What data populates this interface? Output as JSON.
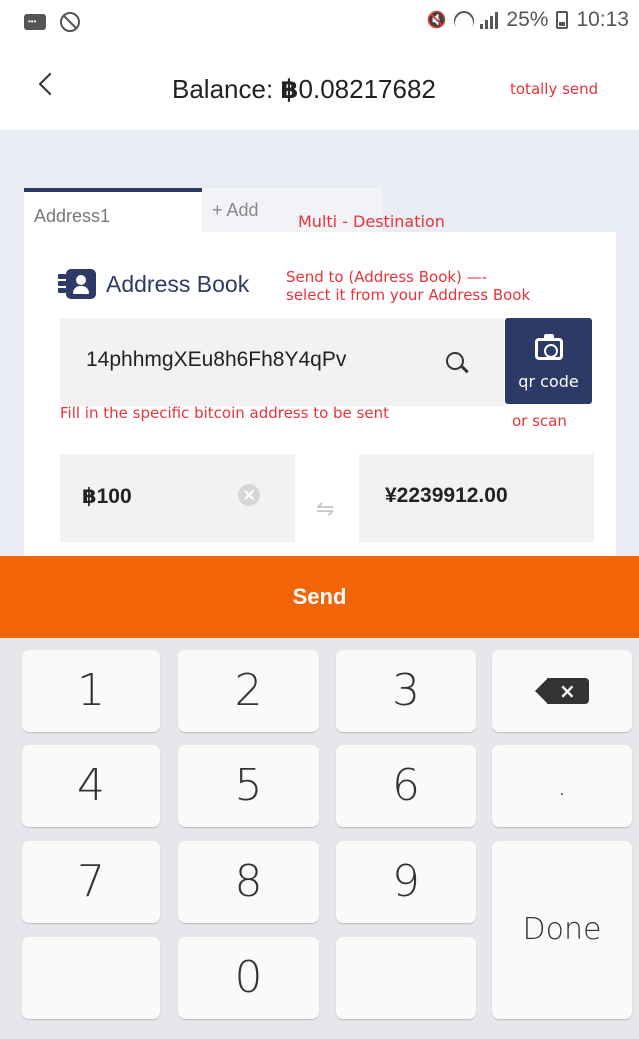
{
  "status_bar": {
    "battery_percent": "25%",
    "time": "10:13"
  },
  "header": {
    "balance_label": "Balance:",
    "balance_symbol": "฿",
    "balance_value": "0.08217682",
    "annotation": "totally send"
  },
  "tabs": {
    "items": [
      {
        "label": "Address1",
        "active": true
      },
      {
        "label": "+ Add",
        "active": false
      }
    ],
    "annotation": "Multi - Destination"
  },
  "address_book": {
    "label": "Address Book",
    "annotation_line1": "Send to (Address Book) —-",
    "annotation_line2": "select it from your Address Book"
  },
  "address_input": {
    "value": "14phhmgXEu8h6Fh8Y4qPv",
    "annotation": "Fill in the specific bitcoin address to be sent"
  },
  "qr_button": {
    "label": "qr code",
    "annotation": "or scan"
  },
  "amount": {
    "btc_value": "฿100",
    "fiat_value": "¥2239912.00",
    "swap_symbol": "⇋"
  },
  "send_button": {
    "label": "Send"
  },
  "keyboard": {
    "keys": [
      "1",
      "2",
      "3",
      "4",
      "5",
      "6",
      "7",
      "8",
      "9",
      "0"
    ],
    "dot": ".",
    "delete_symbol": "×",
    "done": "Done"
  },
  "colors": {
    "accent_navy": "#2d3a66",
    "send_orange": "#f36408",
    "annotation_red": "#e8323c"
  }
}
